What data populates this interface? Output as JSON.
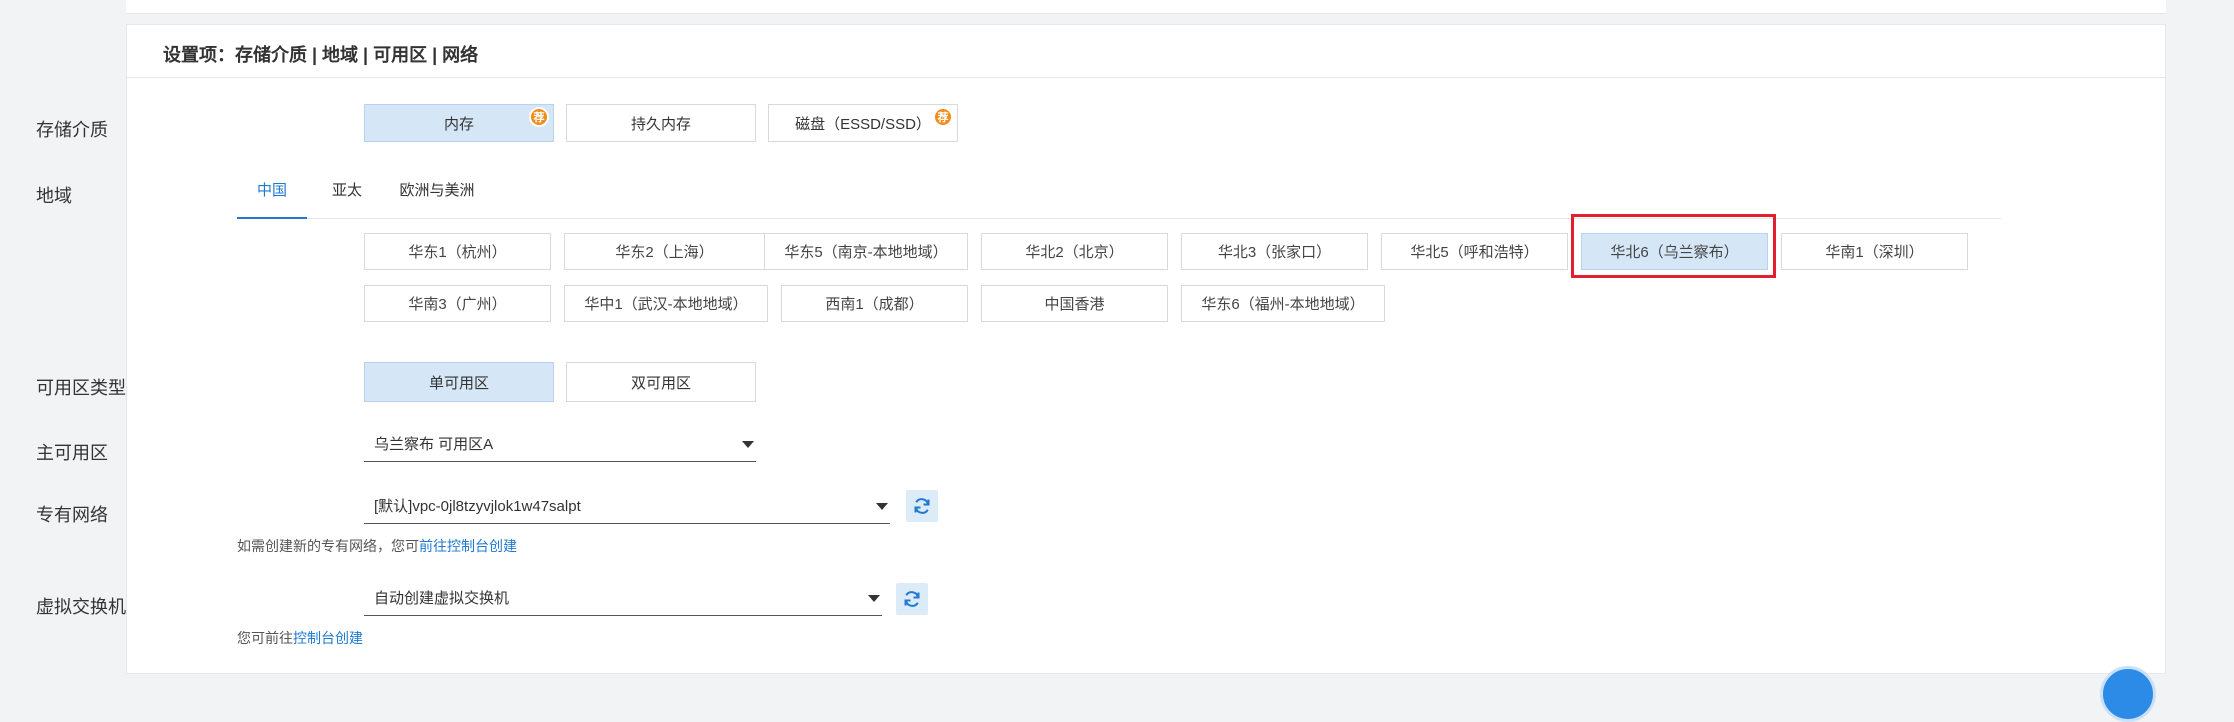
{
  "section": {
    "title": "设置项：存储介质 | 地域 | 可用区 | 网络"
  },
  "storage": {
    "label": "存储介质",
    "options": [
      {
        "label": "内存",
        "selected": true,
        "badge": "荐"
      },
      {
        "label": "持久内存",
        "selected": false,
        "badge": ""
      },
      {
        "label": "磁盘（ESSD/SSD）",
        "selected": false,
        "badge": "荐"
      }
    ]
  },
  "region": {
    "label": "地域",
    "tabs": [
      "中国",
      "亚太",
      "欧洲与美洲"
    ],
    "active_tab": "中国",
    "row1": [
      "华东1（杭州）",
      "华东2（上海）",
      "华东5（南京-本地地域）",
      "华北2（北京）",
      "华北3（张家口）",
      "华北5（呼和浩特）",
      "华北6（乌兰察布）",
      "华南1（深圳）"
    ],
    "row2": [
      "华南3（广州）",
      "华中1（武汉-本地地域）",
      "西南1（成都）",
      "中国香港",
      "华东6（福州-本地地域）"
    ],
    "selected": "华北6（乌兰察布）"
  },
  "zone_type": {
    "label": "可用区类型",
    "options": [
      {
        "label": "单可用区",
        "selected": true
      },
      {
        "label": "双可用区",
        "selected": false
      }
    ]
  },
  "primary_zone": {
    "label": "主可用区",
    "value": "乌兰察布 可用区A"
  },
  "vpc": {
    "label": "专有网络",
    "value": "[默认]vpc-0jl8tzyvjlok1w47salpt",
    "hint_prefix": "如需创建新的专有网络，您可",
    "hint_link": "前往控制台创建"
  },
  "vswitch": {
    "label": "虚拟交换机",
    "value": "自动创建虚拟交换机",
    "hint_prefix": "您可前往",
    "hint_link": "控制台创建"
  },
  "colors": {
    "accent": "#1f79d0",
    "selected_bg": "#d5e7f6",
    "badge": "#f08c1a",
    "highlight": "#e0202e"
  }
}
